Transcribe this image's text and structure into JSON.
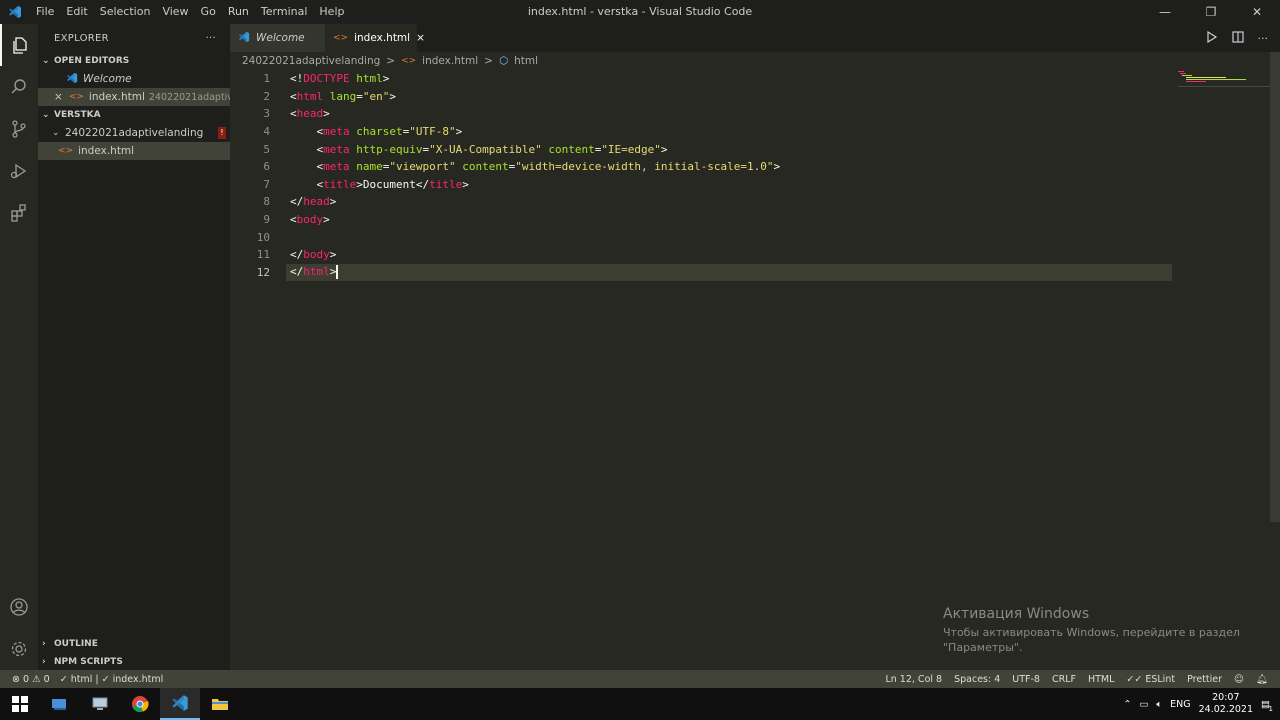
{
  "titlebar": {
    "menu": [
      "File",
      "Edit",
      "Selection",
      "View",
      "Go",
      "Run",
      "Terminal",
      "Help"
    ],
    "title": "index.html - verstka - Visual Studio Code"
  },
  "sidebar": {
    "header": "EXPLORER",
    "more": "···",
    "open_editors": {
      "label": "OPEN EDITORS",
      "items": [
        {
          "name": "Welcome"
        },
        {
          "name": "index.html",
          "desc": "24022021adaptivelan..."
        }
      ]
    },
    "workspace": {
      "label": "VERSTKA",
      "folder": "24022021adaptivelanding",
      "folder_badge": "!",
      "file": "index.html"
    },
    "outline": "OUTLINE",
    "npm": "NPM SCRIPTS"
  },
  "tabs": [
    {
      "label": "Welcome"
    },
    {
      "label": "index.html",
      "close": "×"
    }
  ],
  "breadcrumb": {
    "folder": "24022021adaptivelanding",
    "file": "index.html",
    "element": "html",
    "sep": ">"
  },
  "editor": {
    "line_numbers": [
      "1",
      "2",
      "3",
      "4",
      "5",
      "6",
      "7",
      "8",
      "9",
      "10",
      "11",
      "12"
    ],
    "lines": {
      "l1": {
        "a": "<!",
        "b": "DOCTYPE",
        "c": " ",
        "d": "html",
        "e": ">"
      },
      "l2": {
        "a": "<",
        "b": "html",
        "c": " ",
        "d": "lang",
        "e": "=",
        "f": "\"en\"",
        "g": ">"
      },
      "l3": {
        "a": "<",
        "b": "head",
        "c": ">"
      },
      "l4": {
        "indent": "    ",
        "a": "<",
        "b": "meta",
        "c": " ",
        "d": "charset",
        "e": "=",
        "f": "\"UTF-8\"",
        "g": ">"
      },
      "l5": {
        "indent": "    ",
        "a": "<",
        "b": "meta",
        "c": " ",
        "d": "http-equiv",
        "e": "=",
        "f": "\"X-UA-Compatible\"",
        "g": " ",
        "h": "content",
        "i": "=",
        "j": "\"IE=edge\"",
        "k": ">"
      },
      "l6": {
        "indent": "    ",
        "a": "<",
        "b": "meta",
        "c": " ",
        "d": "name",
        "e": "=",
        "f": "\"viewport\"",
        "g": " ",
        "h": "content",
        "i": "=",
        "j": "\"width=device-width, initial-scale=1.0\"",
        "k": ">"
      },
      "l7": {
        "indent": "    ",
        "a": "<",
        "b": "title",
        "c": ">",
        "d": "Document",
        "e": "</",
        "f": "title",
        "g": ">"
      },
      "l8": {
        "a": "</",
        "b": "head",
        "c": ">"
      },
      "l9": {
        "a": "<",
        "b": "body",
        "c": ">"
      },
      "l11": {
        "a": "</",
        "b": "body",
        "c": ">"
      },
      "l12": {
        "a": "</",
        "b": "html",
        "c": ">"
      }
    }
  },
  "activation": {
    "title": "Активация Windows",
    "line1": "Чтобы активировать Windows, перейдите в раздел",
    "line2": "\"Параметры\"."
  },
  "statusbar": {
    "errors": "0",
    "warnings": "0",
    "check1": "html",
    "check2": "index.html",
    "position": "Ln 12, Col 8",
    "spaces": "Spaces: 4",
    "encoding": "UTF-8",
    "eol": "CRLF",
    "language": "HTML",
    "eslint": "ESLint",
    "prettier": "Prettier"
  },
  "taskbar": {
    "lang": "ENG",
    "time": "20:07",
    "date": "24.02.2021",
    "notif_count": "1"
  }
}
